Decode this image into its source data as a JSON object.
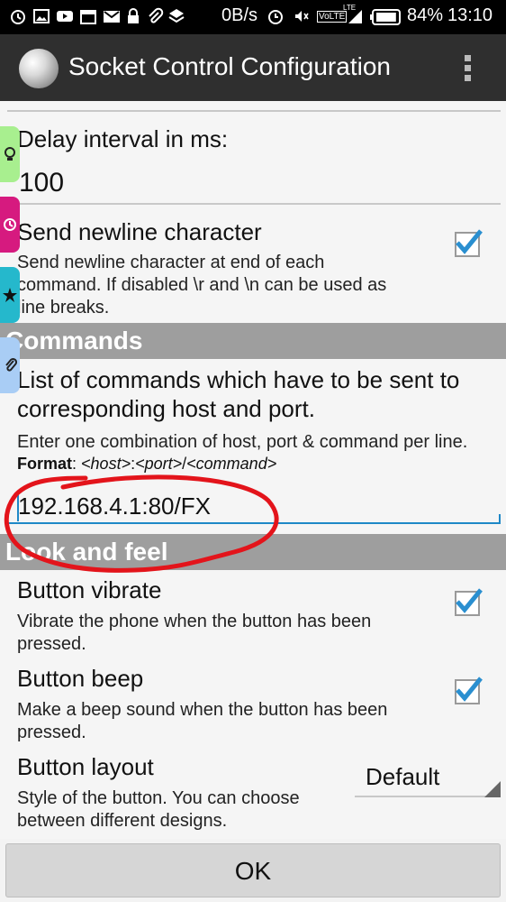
{
  "status_bar": {
    "speed": "0B/s",
    "volte": "VoLTE",
    "lte": "LTE",
    "battery_pct": "84%",
    "time": "13:10",
    "icons": [
      "alarm-icon",
      "image-icon",
      "youtube-icon",
      "calendar-icon",
      "gmail-icon",
      "lock-icon",
      "attachment-icon",
      "layers-icon",
      "alarm-clock-icon",
      "mute-icon",
      "signal-icon",
      "battery-icon"
    ]
  },
  "app": {
    "title": "Socket Control Configuration",
    "icon": "app-logo-icon",
    "menu_icon": "overflow-menu-icon"
  },
  "side_tabs": [
    {
      "icon": "lightbulb-icon",
      "color": "#a8ef8f"
    },
    {
      "icon": "clock-icon",
      "color": "#d61a7f"
    },
    {
      "icon": "star-icon",
      "color": "#25b8cc"
    },
    {
      "icon": "paperclip-icon",
      "color": "#a9cdf5"
    }
  ],
  "delay": {
    "label": "Delay interval in ms:",
    "value": "100"
  },
  "newline": {
    "title": "Send newline character",
    "summary_line1": "Send newline character at end of each",
    "summary_line2": "command. If disabled \\r and \\n can be used as",
    "summary_line3": "line breaks.",
    "checked": true
  },
  "commands": {
    "category": "Commands",
    "title_line1": "List of commands which have to be sent to",
    "title_line2": "corresponding host and port.",
    "summary": "Enter one combination of host, port & command per line.",
    "format_label": "Format",
    "format_sep": ": ",
    "format_host": "<host>",
    "format_colon": ":",
    "format_port": "<port>",
    "format_slash": "/",
    "format_command": "<command>",
    "input_value": "192.168.4.1:80/FX"
  },
  "look_and_feel": {
    "category": "Look and feel",
    "vibrate_title": "Button vibrate",
    "vibrate_summary_line1": "Vibrate the phone when the button has been",
    "vibrate_summary_line2": "pressed.",
    "vibrate_checked": true,
    "beep_title": "Button beep",
    "beep_summary_line1": "Make a beep sound when the button has been",
    "beep_summary_line2": "pressed.",
    "beep_checked": true,
    "layout_title": "Button layout",
    "layout_summary_line1": "Style of the button. You can choose",
    "layout_summary_line2": "between different designs.",
    "layout_value": "Default"
  },
  "footer": {
    "ok_label": "OK"
  },
  "colors": {
    "accent": "#1e88c7",
    "check": "#2a8fd0",
    "annotation": "#e3141b",
    "category_bg": "#9e9e9e"
  }
}
